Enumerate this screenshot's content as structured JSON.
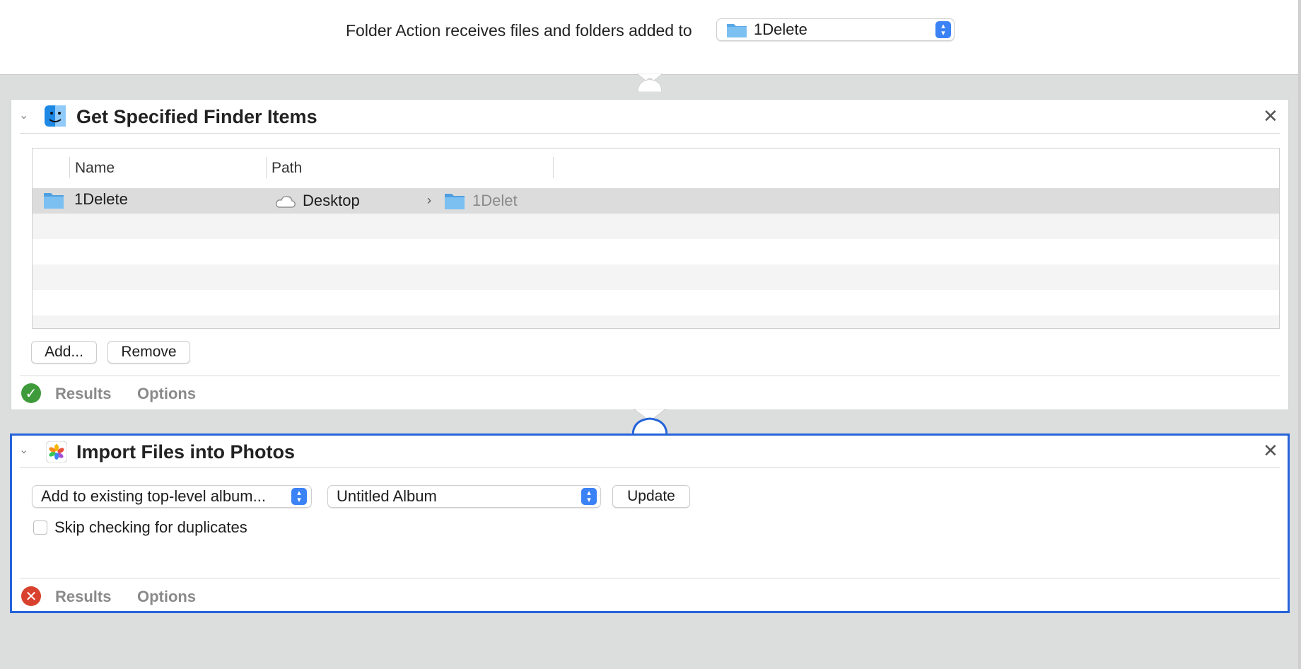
{
  "folder_action": {
    "label": "Folder Action receives files and folders added to",
    "selected_folder": "1Delete"
  },
  "action1": {
    "title": "Get Specified Finder Items",
    "icon": "finder-icon",
    "columns": [
      "Name",
      "Path"
    ],
    "rows": [
      {
        "name": "1Delete",
        "path_root": "Desktop",
        "path_item": "1Delet"
      }
    ],
    "add_label": "Add...",
    "remove_label": "Remove",
    "status": "success",
    "results_label": "Results",
    "options_label": "Options"
  },
  "action2": {
    "title": "Import Files into Photos",
    "icon": "photos-icon",
    "album_mode": "Add to existing top-level album...",
    "album_name": "Untitled Album",
    "update_label": "Update",
    "skip_duplicates_label": "Skip checking for duplicates",
    "skip_duplicates_checked": false,
    "status": "error",
    "results_label": "Results",
    "options_label": "Options"
  },
  "colors": {
    "accent": "#3b82f6",
    "selection_border": "#2563d9",
    "success": "#3f9a3c",
    "error": "#d9412f"
  }
}
